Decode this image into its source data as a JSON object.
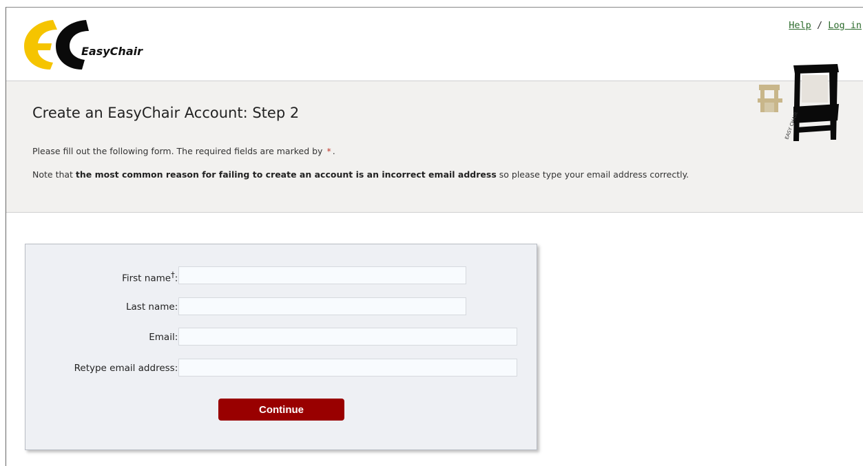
{
  "brand": {
    "logo_text": "EasyChair"
  },
  "top_links": {
    "help": "Help",
    "separator": "/",
    "login": "Log in"
  },
  "page": {
    "title": "Create an EasyChair Account: Step 2",
    "intro": "Please fill out the following form. The required fields are marked by",
    "intro_end": ".",
    "required_marker": "*",
    "note_prefix": "Note that ",
    "note_bold": "the most common reason for failing to create an account is an incorrect email address",
    "note_suffix": " so please type your email address correctly."
  },
  "form": {
    "first_name": {
      "label": "First name",
      "sup": "†",
      "colon": ":",
      "value": ""
    },
    "last_name": {
      "label": "Last name:",
      "value": ""
    },
    "email": {
      "label": "Email:",
      "value": ""
    },
    "retype_email": {
      "label": "Retype email address:",
      "value": ""
    },
    "submit_label": "Continue"
  },
  "colors": {
    "brand_yellow": "#f5c400",
    "button_red": "#990000",
    "link_green": "#2c6b2c",
    "required_red": "#c0392b"
  }
}
